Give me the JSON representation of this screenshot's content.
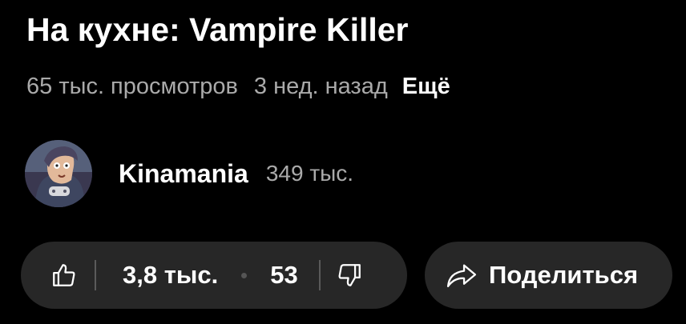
{
  "video": {
    "title": "На кухне: Vampire Killer",
    "views": "65 тыс. просмотров",
    "published": "3 нед. назад",
    "more_label": "Ещё"
  },
  "channel": {
    "name": "Kinamania",
    "subscribers": "349 тыс.",
    "avatar_icon": "channel-avatar"
  },
  "actions": {
    "like_icon": "thumbs-up-icon",
    "likes": "3,8 тыс.",
    "comments": "53",
    "dislike_icon": "thumbs-down-icon",
    "share_icon": "share-arrow-icon",
    "share_label": "Поделиться"
  },
  "colors": {
    "background": "#000000",
    "pill": "#272727",
    "secondary_text": "#aaaaaa",
    "primary_text": "#ffffff"
  }
}
